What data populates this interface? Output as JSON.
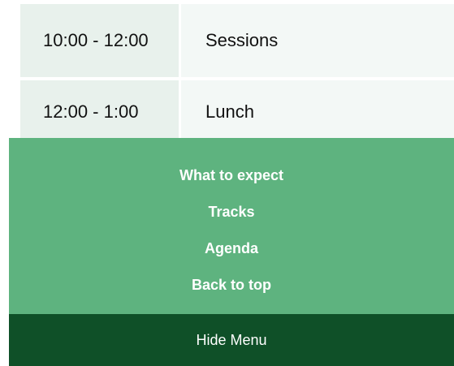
{
  "agenda": {
    "rows": [
      {
        "time": "10:00 - 12:00",
        "event": "Sessions"
      },
      {
        "time": "12:00 - 1:00",
        "event": "Lunch"
      }
    ]
  },
  "menu": {
    "links": [
      {
        "label": "What to expect"
      },
      {
        "label": "Tracks"
      },
      {
        "label": "Agenda"
      },
      {
        "label": "Back to top"
      }
    ],
    "hide_label": "Hide Menu"
  },
  "colors": {
    "menu_background": "#5eb37f",
    "hide_bar_background": "#0f5028",
    "time_cell_background": "#e8f1ec",
    "event_cell_background": "#f3f8f6"
  }
}
